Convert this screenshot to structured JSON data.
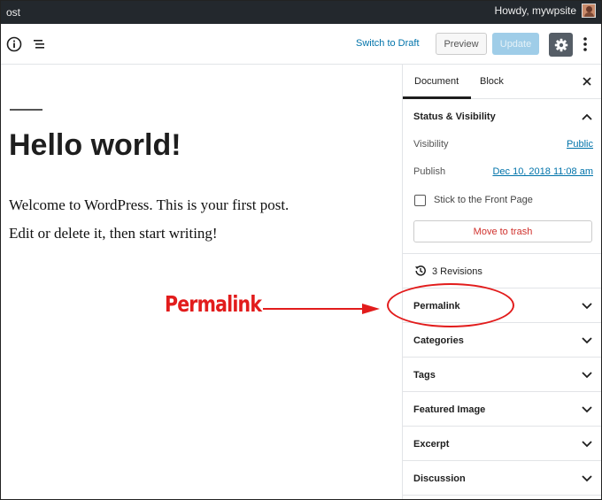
{
  "adminbar": {
    "left_text": "ost",
    "greeting": "Howdy, mywpsite",
    "bg_color": "#23282d"
  },
  "toolbar": {
    "info_icon": "info-icon",
    "outline_icon": "list-outline-icon",
    "switch_to_draft": "Switch to Draft",
    "preview": "Preview",
    "update": "Update",
    "settings_icon": "gear-icon",
    "more_icon": "vertical-ellipsis-icon"
  },
  "post": {
    "title": "Hello world!",
    "paragraphs": [
      "Welcome to WordPress. This is your first post.",
      "Edit or delete it, then start writing!"
    ]
  },
  "annotation": {
    "label": "Permalink",
    "color": "#e21c1c"
  },
  "sidebar": {
    "tabs": [
      {
        "label": "Document",
        "active": true
      },
      {
        "label": "Block",
        "active": false
      }
    ],
    "status": {
      "title": "Status & Visibility",
      "visibility_label": "Visibility",
      "visibility_value": "Public",
      "publish_label": "Publish",
      "publish_value": "Dec 10, 2018 11:08 am",
      "sticky_label": "Stick to the Front Page",
      "sticky_checked": false,
      "trash_label": "Move to trash"
    },
    "revisions": "3 Revisions",
    "panels": [
      {
        "title": "Permalink"
      },
      {
        "title": "Categories"
      },
      {
        "title": "Tags"
      },
      {
        "title": "Featured Image"
      },
      {
        "title": "Excerpt"
      },
      {
        "title": "Discussion"
      }
    ]
  }
}
